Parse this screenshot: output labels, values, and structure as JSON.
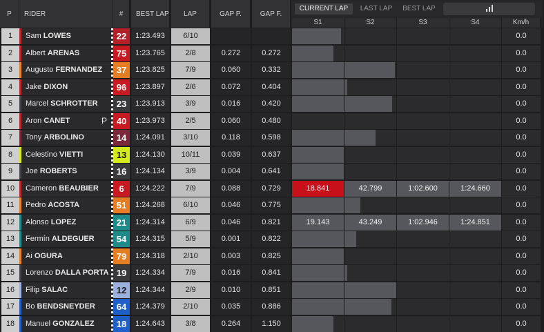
{
  "header": {
    "pos": "P",
    "rider": "RIDER",
    "number": "#",
    "best_lap": "BEST LAP",
    "lap": "LAP",
    "gap_p": "GAP P.",
    "gap_f": "GAP F."
  },
  "tabs": [
    "CURRENT LAP",
    "LAST LAP",
    "BEST LAP"
  ],
  "active_tab": "CURRENT LAP",
  "stats_icon": "bar-chart-icon",
  "sectors": [
    "S1",
    "S2",
    "S3",
    "S4",
    "Km/h"
  ],
  "rows": [
    {
      "pos": "1",
      "first": "Sam",
      "last": "LOWES",
      "num": "22",
      "num_color": "#b3202a",
      "best": "1:23.493",
      "lap": "6/10",
      "gap_p": "",
      "gap_f": "",
      "team_color": "#c0262d",
      "pole": "",
      "s": [
        0.95,
        0,
        0,
        0
      ],
      "texts": [
        "",
        "",
        "",
        ""
      ],
      "kmh": "0.0"
    },
    {
      "pos": "2",
      "first": "Albert",
      "last": "ARENAS",
      "num": "75",
      "num_color": "#c81a22",
      "best": "1:23.765",
      "lap": "2/8",
      "gap_p": "0.272",
      "gap_f": "0.272",
      "team_color": "#c0262d",
      "pole": "",
      "s": [
        0.8,
        0,
        0,
        0
      ],
      "texts": [
        "",
        "",
        "",
        ""
      ],
      "kmh": "0.0"
    },
    {
      "pos": "3",
      "first": "Augusto",
      "last": "FERNANDEZ",
      "num": "37",
      "num_color": "#e57d22",
      "best": "1:23.825",
      "lap": "7/9",
      "gap_p": "0.060",
      "gap_f": "0.332",
      "team_color": "#e57d22",
      "pole": "",
      "s": [
        1.0,
        0.97,
        0,
        0
      ],
      "texts": [
        "",
        "",
        "",
        ""
      ],
      "kmh": "0.0"
    },
    {
      "pos": "4",
      "first": "Jake",
      "last": "DIXON",
      "num": "96",
      "num_color": "#c81a22",
      "best": "1:23.897",
      "lap": "2/6",
      "gap_p": "0.072",
      "gap_f": "0.404",
      "team_color": "#c0262d",
      "pole": "",
      "s": [
        1.0,
        0.05,
        0,
        0
      ],
      "texts": [
        "",
        "",
        "",
        ""
      ],
      "kmh": "0.0"
    },
    {
      "pos": "5",
      "first": "Marcel",
      "last": "SCHROTTER",
      "num": "23",
      "num_color": "#3a3a3c",
      "best": "1:23.913",
      "lap": "3/9",
      "gap_p": "0.016",
      "gap_f": "0.420",
      "team_color": "#444448",
      "pole": "",
      "s": [
        1.0,
        0.92,
        0,
        0
      ],
      "texts": [
        "",
        "",
        "",
        ""
      ],
      "kmh": "0.0"
    },
    {
      "pos": "6",
      "first": "Aron",
      "last": "CANET",
      "num": "40",
      "num_color": "#c81a22",
      "best": "1:23.973",
      "lap": "2/5",
      "gap_p": "0.060",
      "gap_f": "0.480",
      "team_color": "#c0262d",
      "pole": "P",
      "s": [
        0,
        0,
        0,
        0
      ],
      "texts": [
        "",
        "",
        "",
        ""
      ],
      "kmh": "0.0"
    },
    {
      "pos": "7",
      "first": "Tony",
      "last": "ARBOLINO",
      "num": "14",
      "num_color": "#7a2a3a",
      "best": "1:24.091",
      "lap": "3/10",
      "gap_p": "0.118",
      "gap_f": "0.598",
      "team_color": "#7a2a3a",
      "pole": "",
      "s": [
        1.0,
        0.6,
        0,
        0
      ],
      "texts": [
        "",
        "",
        "",
        ""
      ],
      "kmh": "0.0"
    },
    {
      "pos": "8",
      "first": "Celestino",
      "last": "VIETTI",
      "num": "13",
      "num_color": "#d4ec1c",
      "best": "1:24.130",
      "lap": "10/11",
      "gap_p": "0.039",
      "gap_f": "0.637",
      "team_color": "#d4ec1c",
      "pole": "",
      "s": [
        1.0,
        0,
        0,
        0
      ],
      "texts": [
        "",
        "",
        "",
        ""
      ],
      "kmh": "0.0"
    },
    {
      "pos": "9",
      "first": "Joe",
      "last": "ROBERTS",
      "num": "16",
      "num_color": "#3a3a3c",
      "best": "1:24.134",
      "lap": "3/9",
      "gap_p": "0.004",
      "gap_f": "0.641",
      "team_color": "#444448",
      "pole": "",
      "s": [
        1.0,
        0,
        0,
        0
      ],
      "texts": [
        "",
        "",
        "",
        ""
      ],
      "kmh": "0.0"
    },
    {
      "pos": "10",
      "first": "Cameron",
      "last": "BEAUBIER",
      "num": "6",
      "num_color": "#c81a22",
      "best": "1:24.222",
      "lap": "7/9",
      "gap_p": "0.088",
      "gap_f": "0.729",
      "team_color": "#c0262d",
      "pole": "",
      "s": [
        1,
        1,
        1,
        1
      ],
      "texts": [
        "18.841",
        "42.799",
        "1:02.600",
        "1:24.660"
      ],
      "red_first": true,
      "kmh": "0.0"
    },
    {
      "pos": "11",
      "first": "Pedro",
      "last": "ACOSTA",
      "num": "51",
      "num_color": "#e57d22",
      "best": "1:24.268",
      "lap": "6/10",
      "gap_p": "0.046",
      "gap_f": "0.775",
      "team_color": "#e57d22",
      "pole": "",
      "s": [
        1.0,
        0.3,
        0,
        0
      ],
      "texts": [
        "",
        "",
        "",
        ""
      ],
      "kmh": "0.0"
    },
    {
      "pos": "12",
      "first": "Alonso",
      "last": "LOPEZ",
      "num": "21",
      "num_color": "#1e8a8a",
      "best": "1:24.314",
      "lap": "6/9",
      "gap_p": "0.046",
      "gap_f": "0.821",
      "team_color": "#1e8a8a",
      "pole": "",
      "s": [
        1,
        1,
        1,
        1
      ],
      "texts": [
        "19.143",
        "43.249",
        "1:02.946",
        "1:24.851"
      ],
      "red_first": false,
      "kmh": "0.0"
    },
    {
      "pos": "13",
      "first": "Fermín",
      "last": "ALDEGUER",
      "num": "54",
      "num_color": "#1e8a8a",
      "best": "1:24.315",
      "lap": "5/9",
      "gap_p": "0.001",
      "gap_f": "0.822",
      "team_color": "#1e8a8a",
      "pole": "",
      "s": [
        1.0,
        0.22,
        0,
        0
      ],
      "texts": [
        "",
        "",
        "",
        ""
      ],
      "kmh": "0.0"
    },
    {
      "pos": "14",
      "first": "Ai",
      "last": "OGURA",
      "num": "79",
      "num_color": "#e57d22",
      "best": "1:24.318",
      "lap": "2/10",
      "gap_p": "0.003",
      "gap_f": "0.825",
      "team_color": "#e57d22",
      "pole": "",
      "s": [
        1.0,
        0,
        0,
        0
      ],
      "texts": [
        "",
        "",
        "",
        ""
      ],
      "kmh": "0.0"
    },
    {
      "pos": "15",
      "first": "Lorenzo",
      "last": "DALLA PORTA",
      "num": "19",
      "num_color": "#3a3a3c",
      "best": "1:24.334",
      "lap": "7/9",
      "gap_p": "0.016",
      "gap_f": "0.841",
      "team_color": "#444448",
      "pole": "",
      "s": [
        1.0,
        0.05,
        0,
        0
      ],
      "texts": [
        "",
        "",
        "",
        ""
      ],
      "kmh": "0.0"
    },
    {
      "pos": "16",
      "first": "Filip",
      "last": "SALAC",
      "num": "12",
      "num_color": "#9bb0dc",
      "best": "1:24.344",
      "lap": "2/9",
      "gap_p": "0.010",
      "gap_f": "0.851",
      "team_color": "#9bb0dc",
      "pole": "",
      "s": [
        1.0,
        1.0,
        0,
        0
      ],
      "texts": [
        "",
        "",
        "",
        ""
      ],
      "kmh": "0.0"
    },
    {
      "pos": "17",
      "first": "Bo",
      "last": "BENDSNEYDER",
      "num": "64",
      "num_color": "#1f5fc8",
      "best": "1:24.379",
      "lap": "2/10",
      "gap_p": "0.035",
      "gap_f": "0.886",
      "team_color": "#1f5fc8",
      "pole": "",
      "s": [
        1.0,
        0.9,
        0,
        0
      ],
      "texts": [
        "",
        "",
        "",
        ""
      ],
      "kmh": "0.0"
    },
    {
      "pos": "18",
      "first": "Manuel",
      "last": "GONZALEZ",
      "num": "18",
      "num_color": "#1f5fc8",
      "best": "1:24.643",
      "lap": "3/8",
      "gap_p": "0.264",
      "gap_f": "1.150",
      "team_color": "#1f5fc8",
      "pole": "",
      "s": [
        0.8,
        0,
        0,
        0
      ],
      "texts": [
        "",
        "",
        "",
        ""
      ],
      "kmh": "0.0"
    }
  ]
}
